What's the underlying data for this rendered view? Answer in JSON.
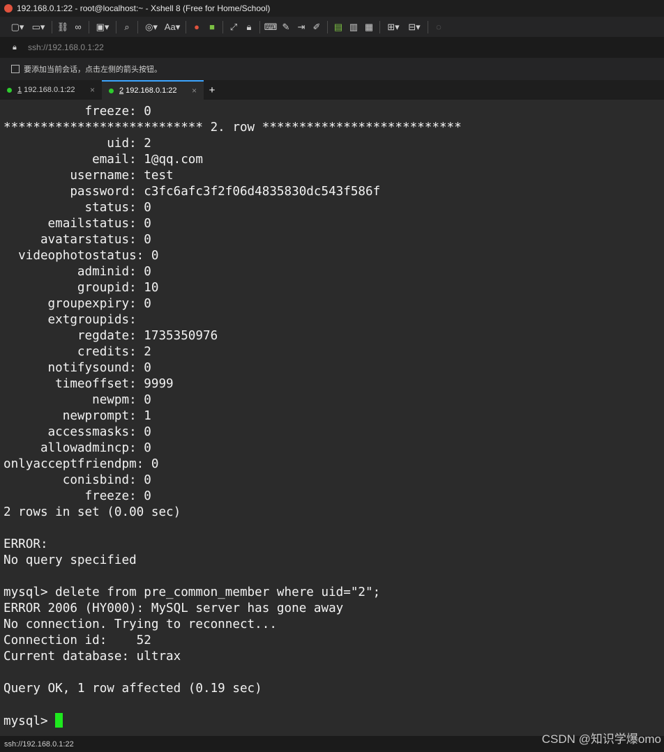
{
  "window": {
    "title": "192.168.0.1:22 - root@localhost:~ - Xshell 8 (Free for Home/School)"
  },
  "toolbar": {
    "icons": [
      "new-session-icon",
      "open-icon",
      "link-icon",
      "unlink-icon",
      "properties-icon",
      "search-icon",
      "globe-icon",
      "font-icon",
      "xftp-icon",
      "xagent-icon",
      "fullscreen-icon",
      "lock-icon",
      "keyboard-icon",
      "compose-icon",
      "transfer-icon",
      "script-icon",
      "log-icon",
      "tunnel-icon",
      "notes-icon",
      "new-tab-icon",
      "layout-icon",
      "help-icon"
    ],
    "font_label": "Aa"
  },
  "address": {
    "value": "ssh://192.168.0.1:22"
  },
  "hint": {
    "text": "要添加当前会话，点击左侧的箭头按钮。"
  },
  "tabs": [
    {
      "num": "1",
      "label": "192.168.0.1:22",
      "active": false
    },
    {
      "num": "2",
      "label": "192.168.0.1:22",
      "active": true
    }
  ],
  "terminal": {
    "lines": [
      "           freeze: 0",
      "*************************** 2. row ***************************",
      "              uid: 2",
      "            email: 1@qq.com",
      "         username: test",
      "         password: c3fc6afc3f2f06d4835830dc543f586f",
      "           status: 0",
      "      emailstatus: 0",
      "     avatarstatus: 0",
      "  videophotostatus: 0",
      "          adminid: 0",
      "          groupid: 10",
      "      groupexpiry: 0",
      "      extgroupids: ",
      "          regdate: 1735350976",
      "          credits: 2",
      "      notifysound: 0",
      "       timeoffset: 9999",
      "            newpm: 0",
      "        newprompt: 1",
      "      accessmasks: 0",
      "     allowadmincp: 0",
      "onlyacceptfriendpm: 0",
      "        conisbind: 0",
      "           freeze: 0",
      "2 rows in set (0.00 sec)",
      "",
      "ERROR:",
      "No query specified",
      "",
      "mysql> delete from pre_common_member where uid=\"2\";",
      "ERROR 2006 (HY000): MySQL server has gone away",
      "No connection. Trying to reconnect...",
      "Connection id:    52",
      "Current database: ultrax",
      "",
      "Query OK, 1 row affected (0.19 sec)",
      "",
      "mysql> "
    ]
  },
  "status": {
    "text": "ssh://192.168.0.1:22"
  },
  "watermark": "CSDN @知识学爆omo",
  "colors": {
    "cursor": "#1ee81e",
    "active_tab_accent": "#3da5ff",
    "terminal_bg": "#2b2b2b"
  }
}
